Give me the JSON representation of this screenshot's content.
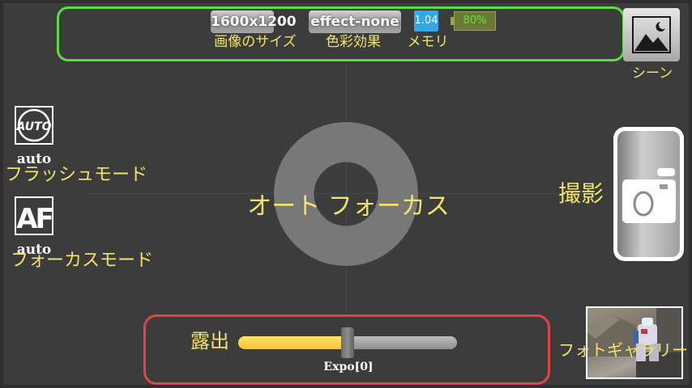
{
  "status_bar": {
    "resolution": "1600x1200",
    "resolution_label": "画像のサイズ",
    "effect": "effect-none",
    "effect_label": "色彩効果",
    "memory_value": "1.04",
    "memory_label": "メモリ",
    "battery": "80%"
  },
  "scene": {
    "label": "シーン",
    "icon": "landscape-night-icon"
  },
  "flash": {
    "icon": "flash-auto-icon",
    "value": "auto",
    "label": "フラッシュモード"
  },
  "focus_mode": {
    "icon": "autofocus-icon",
    "value": "auto",
    "label": "フォーカスモード"
  },
  "viewfinder": {
    "focus_label": "オート フォーカス"
  },
  "shutter": {
    "label": "撮影",
    "icon": "camera-icon"
  },
  "gallery": {
    "label": "フォトギャラリー"
  },
  "exposure": {
    "label": "露出",
    "value_text": "Expo[0]",
    "level_fraction": 0.5
  },
  "colors": {
    "status_border": "#5fdc43",
    "exposure_border": "#e04545",
    "label_yellow": "#f4e36a",
    "memory_blue": "#35a7e8"
  }
}
